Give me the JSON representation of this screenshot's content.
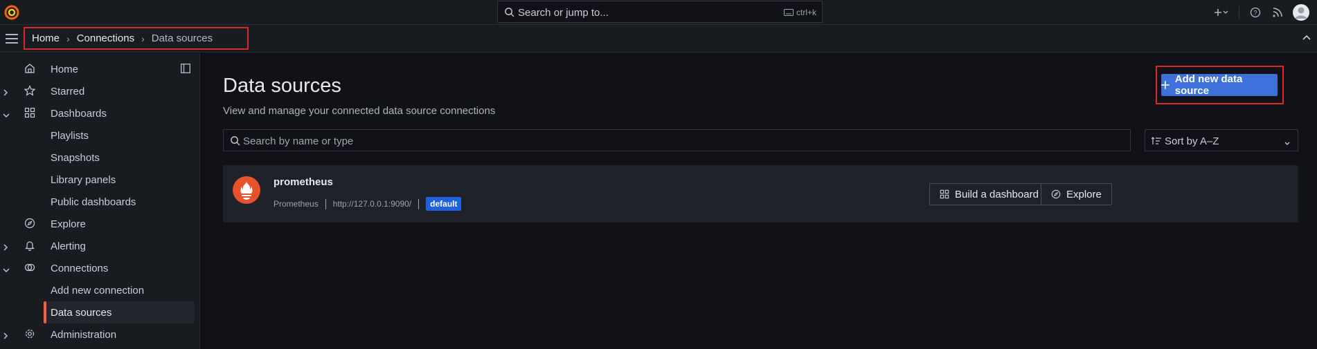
{
  "topbar": {
    "search_placeholder": "Search or jump to...",
    "search_shortcut": "ctrl+k"
  },
  "breadcrumb": {
    "items": [
      "Home",
      "Connections",
      "Data sources"
    ]
  },
  "sidebar": {
    "items": [
      {
        "label": "Home"
      },
      {
        "label": "Starred"
      },
      {
        "label": "Dashboards"
      },
      {
        "label": "Playlists"
      },
      {
        "label": "Snapshots"
      },
      {
        "label": "Library panels"
      },
      {
        "label": "Public dashboards"
      },
      {
        "label": "Explore"
      },
      {
        "label": "Alerting"
      },
      {
        "label": "Connections"
      },
      {
        "label": "Add new connection"
      },
      {
        "label": "Data sources"
      },
      {
        "label": "Administration"
      }
    ]
  },
  "page": {
    "title": "Data sources",
    "subtitle": "View and manage your connected data source connections",
    "add_button": "Add new data source",
    "filter_placeholder": "Search by name or type",
    "sort_value": "Sort by A–Z"
  },
  "datasources": [
    {
      "name": "prometheus",
      "type": "Prometheus",
      "url": "http://127.0.0.1:9090/",
      "badge": "default",
      "build_label": "Build a dashboard",
      "explore_label": "Explore"
    }
  ],
  "colors": {
    "accent": "#f55f3e",
    "primary": "#3d71d9",
    "badge": "#1f62e0",
    "highlight": "#e02828"
  }
}
